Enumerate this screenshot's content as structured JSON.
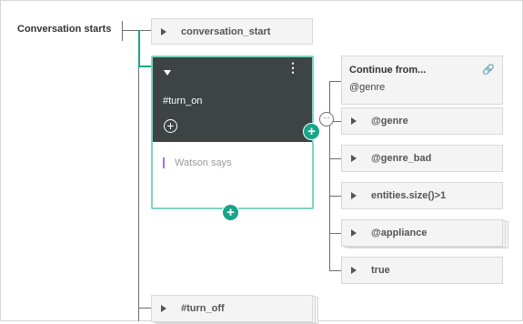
{
  "root_label": "Conversation starts",
  "nodes": {
    "conversation_start": "conversation_start",
    "turn_off": "#turn_off"
  },
  "selected_node": {
    "condition": "#turn_on",
    "response_placeholder": "Watson says"
  },
  "jump_to": {
    "title": "Continue from...",
    "target": "@genre"
  },
  "children": [
    "@genre",
    "@genre_bad",
    "entities.size()>1",
    "@appliance",
    "true"
  ],
  "icons": {
    "add": "+",
    "more": "⋮",
    "link": "🔗",
    "chat": "···"
  },
  "colors": {
    "accent": "#17a58a",
    "selected_border": "#7fd3c2",
    "node_header": "#3d4443"
  }
}
